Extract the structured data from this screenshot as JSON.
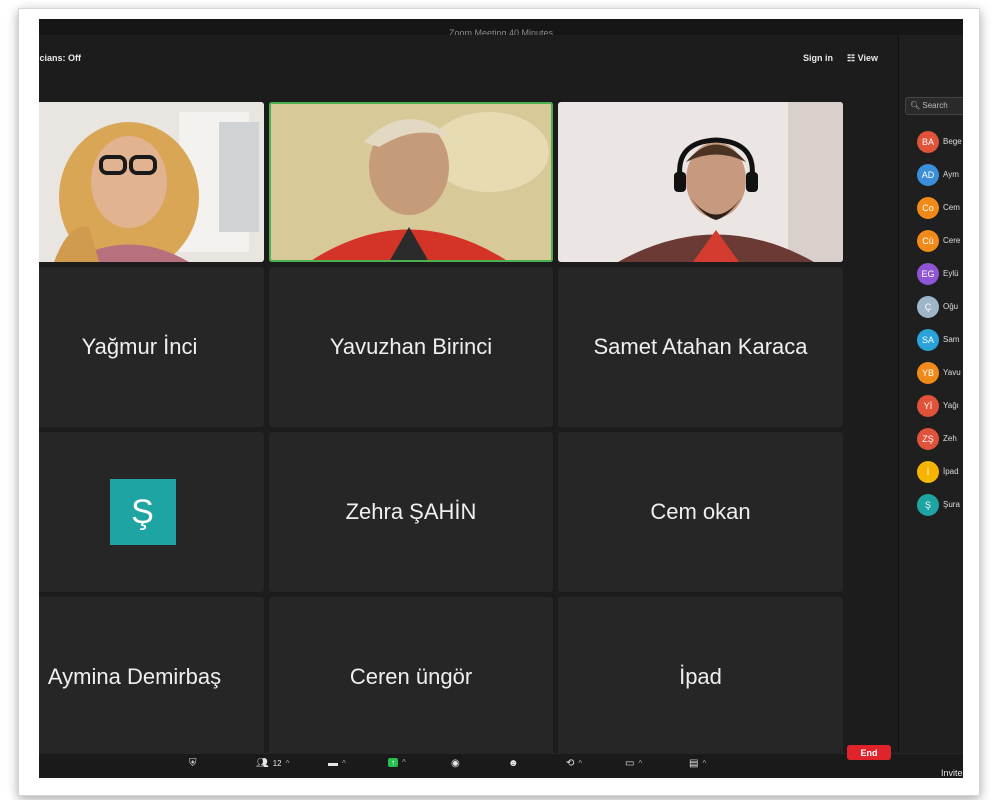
{
  "window": {
    "title": "Zoom Meeting  40 Minutes"
  },
  "info": {
    "left_text": "icians: Off",
    "sign_in": "Sign in",
    "view": "View"
  },
  "video_tiles": [
    {
      "id": "video-1"
    },
    {
      "id": "video-2",
      "active": true
    },
    {
      "id": "video-3"
    }
  ],
  "name_tiles": [
    "Yağmur İnci",
    "Yavuzhan Birinci",
    "Samet Atahan Karaca",
    "Ş",
    "Zehra ŞAHİN",
    "Cem okan",
    "Aymina Demirbaş",
    "Ceren üngör",
    "İpad"
  ],
  "sidebar": {
    "search_placeholder": "Search",
    "participants": [
      {
        "initials": "BA",
        "name": "Bege",
        "color": "#e0533a"
      },
      {
        "initials": "AD",
        "name": "Aym",
        "color": "#3b8fd8"
      },
      {
        "initials": "Co",
        "name": "Cem",
        "color": "#f08a18"
      },
      {
        "initials": "Cü",
        "name": "Cere",
        "color": "#f08a18"
      },
      {
        "initials": "EG",
        "name": "Eylü",
        "color": "#8e55d6"
      },
      {
        "initials": "Ç",
        "name": "Oğu",
        "color": "#9fb6c9"
      },
      {
        "initials": "SA",
        "name": "Sam",
        "color": "#2aa3d9"
      },
      {
        "initials": "YB",
        "name": "Yavu",
        "color": "#f08a18"
      },
      {
        "initials": "Yİ",
        "name": "Yağı",
        "color": "#e0533a"
      },
      {
        "initials": "ZŞ",
        "name": "Zeh",
        "color": "#e0533a"
      },
      {
        "initials": "İ",
        "name": "İpad",
        "color": "#f5b400"
      },
      {
        "initials": "Ş",
        "name": "Şura",
        "color": "#1ea4a2"
      }
    ]
  },
  "toolbar": {
    "participants_count": "12",
    "end_label": "End",
    "invite_label": "Invite"
  }
}
